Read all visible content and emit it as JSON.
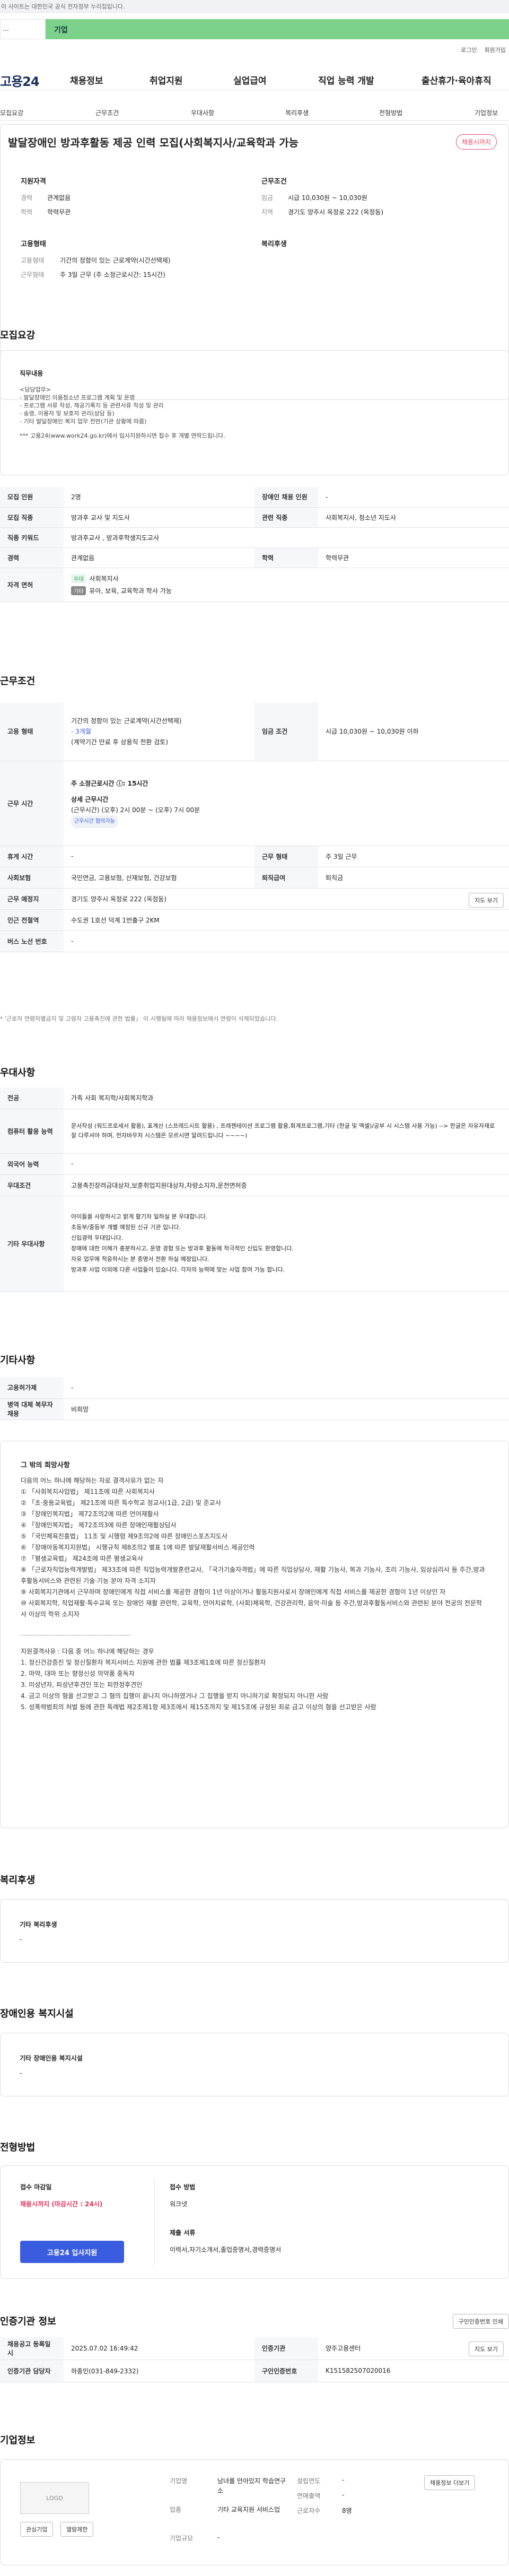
{
  "top_notice": "이 사이트는 대한민국 공식 전자정부 누리집입니다.",
  "gov_left": "…",
  "gov_right": "기업",
  "util": [
    "로그인",
    "회원가입"
  ],
  "logo": "고용24",
  "gnb": [
    "채용정보",
    "취업지원",
    "실업급여",
    "직업 능력 개발",
    "출산휴가·육아휴직"
  ],
  "snb": [
    "모집요강",
    "근무조건",
    "우대사항",
    "복리후생",
    "전형방법",
    "기업정보"
  ],
  "header": {
    "title": "발달장애인 방과후활동 제공 인력 모집(사회복지사/교육학과 가능",
    "badge": "채용시까지",
    "apply_title": "지원자격",
    "career_k": "경력",
    "career_v": "관계없음",
    "edu_k": "학력",
    "edu_v": "학력무관",
    "work_title": "근무조건",
    "pay_k": "임금",
    "pay_v": "시급 10,030원 ~ 10,030원",
    "loc_k": "지역",
    "loc_v": "경기도 양주시 옥정로 222 (옥정동)",
    "emp_title": "고용형태",
    "emptype_k": "고용형태",
    "emptype_v": "기간의 정함이 있는 근로계약(시간선택제)",
    "hours_k": "근무형태",
    "hours_v": "주 3일 근무 (주 소정근로시간: 15시간)",
    "welfare_title": "복리후생"
  },
  "recruit": {
    "section": "모집요강",
    "duty_title": "직무내용",
    "duty_lines": [
      "<담당업무>",
      "- 발달장애인 이용청소년 프로그램 계획 및 운영",
      "- 프로그램 서류 작성, 제공기록지 등 관련서류 작성 및 관리",
      "- 송영, 이용자 및 보호자 관리(상담 등)",
      "- 기타 발달장애인 복지 업무 전반(기관 상황에 따름)",
      "*** 고용24(www.work24.go.kr)에서 입사지원하시면 접수 후 개별 연락드립니다."
    ],
    "rows": [
      {
        "k": "모집 인원",
        "v": "2명",
        "k2": "장애인 채용 인원",
        "v2": "-"
      },
      {
        "k": "모집 직종",
        "v": "방과후 교사 및 지도사",
        "k2": "관련 직종",
        "v2": "사회복지사, 청소년 지도사"
      },
      {
        "k": "직종 키워드",
        "v": "방과후교사 , 방과후학생지도교사",
        "k2": "",
        "v2": ""
      },
      {
        "k": "경력",
        "v": "관계없음",
        "k2": "학력",
        "v2": "학력무관"
      }
    ],
    "license_k": "자격 면허",
    "license_tag1": "우대",
    "license_v1": "사회복지사",
    "license_tag2": "기타",
    "license_v2": "유아, 보육, 교육학과 학사 가능"
  },
  "conditions": {
    "section": "근무조건",
    "emptype_k": "고용 형태",
    "emptype_v1": "기간의 정함이 있는 근로계약(시간선택제)",
    "emptype_v2": "- 3개월",
    "emptype_v3": "(계약기간 만료 후 상용직 전환 검토)",
    "pay_k": "임금 조건",
    "pay_v": "시급 10,030원 ~ 10,030원 이하",
    "time_k": "근무 시간",
    "time_v1": "주 소정근로시간 ⓘ: 15시간",
    "time_v2": "상세 근무시간",
    "time_v3": "(근무시간) (오후) 2시 00분 ~ (오후) 7시 00분",
    "time_chip": "근무시간 협의가능",
    "break_k": "휴게 시간",
    "break_v": "-",
    "days_k": "근무 형태",
    "days_v": "주 3일 근무",
    "ins_k": "사회보험",
    "ins_v": "국민연금, 고용보험, 산재보험, 건강보험",
    "ret_k": "퇴직급여",
    "ret_v": "퇴직금",
    "place_k": "근무 예정지",
    "place_v": "경기도 양주시 옥정로 222 (옥정동)",
    "map_btn": "지도 보기",
    "station_k": "인근 전철역",
    "station_v": "수도권 1호선 덕계 1번출구 2KM",
    "bus_k": "버스 노선 번호",
    "bus_v": "-",
    "note": "* '근로자 연령차별금지 및 고령자 고용촉진에 관한 법률」 이 시행됨에 따라 채용정보에서 연령이 삭제되었습니다."
  },
  "prefs": {
    "section": "우대사항",
    "major_k": "전공",
    "major_v": "가족 사회 복지학/사회복지학과",
    "pc_k": "컴퓨터 활용 능력",
    "pc_v": "문서작성 (워드프로세서 활용), 표계산 (스프레드시트 활용) , 프레젠테이션 프로그램 활용,회계프로그램,기타 (한글 및 엑셀)/공부 시 시스템 사용 가능) --> 한글은 자유자재로 잘 다루셔야 하며, 전자바우처 시스템은 모르시면 알려드립니다 ~~~~)",
    "lang_k": "외국어 능력",
    "lang_v": "-",
    "cond_k": "우대조건",
    "cond_v": "고용촉진장려금대상자,보훈취업지원대상자,차량소지자,운전면허증",
    "other_k": "기타 우대사항",
    "other_lines": [
      "아이들을 사랑하시고 밝게 활기차 일하실 분 우대합니다.",
      "초등부/중등부 개별 예정된 신규 기관 입니다.",
      "신입경력 우대입니다.",
      "장애에 대한 이해가 충분하시고, 운영 경험 또는 방과후 활동에 적극적인 신입도 환영합니다.",
      "자유 업무에 적응하시는 분 증명서 전환 하실 예정입니다.",
      "방과후 사업 이외에 다른 사업들이 있습니다. 각자의 능력에 맞는 사업 참여 가능 합니다."
    ]
  },
  "etc": {
    "section": "기타사항",
    "k1": "고용허가제",
    "v1": "-",
    "k2": "병역 대체 복무자 채용",
    "v2": "비희망",
    "req_title": "그 밖의 희망사항",
    "req_lines": [
      "다음의 어느 하나에 해당하는 자로 결격사유가 없는 자",
      "① 「사회복지사업법」 제11조에 따른 사회복지사",
      "② 「초·중등교육법」 제21조에 따른 특수학교 정교사(1급, 2급) 및 준교사",
      "③ 「장애인복지법」 제72조의2에 따른 언어재활사",
      "④ 「장애인복지법」 제72조의3에 따른 장애인재활상담사",
      "⑤ 「국민체육진흥법」 11조 및 시행령 제9조의2에 따른 장애인스포츠지도사",
      "⑥ 「장애아동복지지원법」 시행규칙 제8조의2 별표 1에 따른 발달재활서비스 제공인력",
      "⑦ 「평생교육법」 제24조에 따른 평생교육사",
      "⑧ 「근로자직업능력개발법」 제33조에 따른 직업능력개발훈련교사, 「국가기술자격법」에 따른 직업상담사, 재활 기능사, 복과 기능사, 조리 기능사, 임상심리사 등 주간,방과후활동서비스와 관련된 기술·기능 분야 자격 소지자",
      "⑨ 사회복지기관에서 근무하며 장애인에게 직접 서비스를 제공한 경험이 1년 이상이거나 활동지원사로서 장애인에게 직접 서비스를 제공한 경험이 1년 이상인 자",
      "⑩ 사회복지학, 직업재활·특수교육 또는 장애인 재활 관련학, 교육학, 언어치료학, (사회)체육학, 건강관리학, 음악·미술 등 주간,방과후활동서비스와 관련된 분야 전공의 전문학사 이상의 학위 소지자",
      "------------------------------------------------",
      "지원결격사유 : 다음 중 어느 하나에 해당하는 경우",
      "1. 정신건강증진 및 정신질환자 복지서비스 지원에 관한 법률 제3조제1호에 따른 정신질환자",
      "2. 마약, 대마 또는 향정신성 의약품 중독자",
      "3. 미성년자, 피성년후견인 또는 피한정후견인",
      "4. 금고 이상의 형을 선고받고 그 형의 집행이 끝나지 아니하였거나 그 집행을 받지 아니하기로 확정되지 아니한 사람",
      "5. 성폭력범죄의 처벌 등에 관한 특례법 제2조제1항 제3조에서 제15조까지 및 제15조에 규정된 죄로 금고 이상의 형을 선고받은 사람"
    ]
  },
  "welfare": {
    "section": "복리후생",
    "title": "기타 복리후생",
    "value": "-"
  },
  "disab": {
    "section": "장애인용 복지시설",
    "title": "기타 장애인용 복지시설",
    "value": "-"
  },
  "process": {
    "section": "전형방법",
    "deadline_k": "접수 마감일",
    "deadline_v": "채용시까지 (마감시간 : 24시)",
    "apply_btn": "고용24 입사지원",
    "method_k": "접수 방법",
    "method_v": "워크넷",
    "docs_k": "제출 서류",
    "docs_v": "이력서,자기소개서,졸업증명서,경력증명서"
  },
  "cert": {
    "section": "인증기관 정보",
    "print_btn": "구인인증번호 인쇄",
    "k1": "채용공고 등록일시",
    "v1": "2025.07.02 16:49:42",
    "k2": "인증기관",
    "v2": "양주고용센터",
    "k3": "인증기관 담당자",
    "v3": "하종민(031-849-2332)",
    "k4": "구인인증번호",
    "v4": "K151582507020016",
    "map_btn": "지도 보기"
  },
  "company": {
    "section": "기업정보",
    "logo": "LOGO",
    "fav_btn": "관심기업",
    "blind_btn": "열람제한",
    "name_k": "기업명",
    "name_v": "남녀를 안아있지 학습연구소",
    "ind_k": "업종",
    "ind_v": "기타 교육지원 서비스업",
    "scale_k": "기업규모",
    "scale_v": "-",
    "est_k": "설립연도",
    "est_v": "-",
    "sales_k": "연매출액",
    "sales_v": "-",
    "emp_k": "근로자수",
    "emp_v": "8명",
    "detail_btn": "채용정보 더보기"
  }
}
